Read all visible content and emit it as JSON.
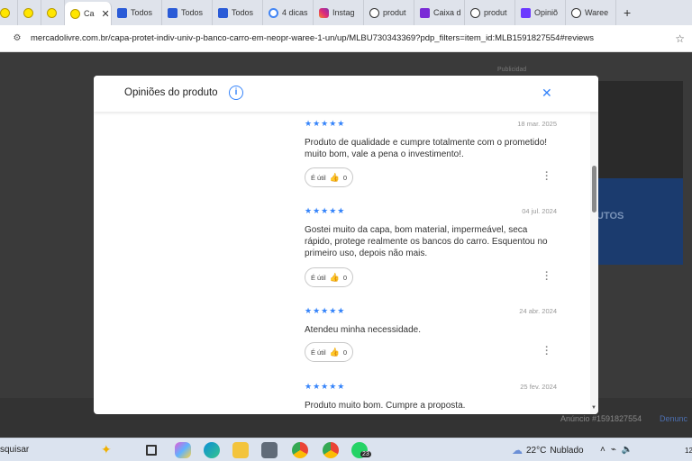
{
  "browser": {
    "tabs": [
      {
        "label": "",
        "icon": "mercadolivre-icon"
      },
      {
        "label": "",
        "icon": "mercadolivre-icon"
      },
      {
        "label": "",
        "icon": "mercadolivre-icon"
      },
      {
        "label": "Ca",
        "icon": "mercadolivre-icon",
        "active": true
      },
      {
        "label": "Todos",
        "icon": "todos-icon"
      },
      {
        "label": "Todos",
        "icon": "todos-icon"
      },
      {
        "label": "Todos",
        "icon": "todos-icon"
      },
      {
        "label": "4 dicas",
        "icon": "google-icon"
      },
      {
        "label": "Instag",
        "icon": "instagram-icon"
      },
      {
        "label": "produt",
        "icon": "globe-icon"
      },
      {
        "label": "Caixa d",
        "icon": "caixa-icon"
      },
      {
        "label": "produt",
        "icon": "globe-icon"
      },
      {
        "label": "Opiniõ",
        "icon": "opiniao-icon"
      },
      {
        "label": "Waree",
        "icon": "globe-icon"
      }
    ],
    "new_tab": "+",
    "close_tab": "✕",
    "url": "mercadolivre.com.br/capa-protet-indiv-univ-p-banco-carro-em-neopr-waree-1-un/up/MLBU730343369?pdp_filters=item_id:MLB1591827554#reviews"
  },
  "background_page": {
    "publicidad": "Publicidad",
    "banner_text": "UTOS",
    "anuncio": "Anúncio #1591827554",
    "denunciar": "Denunc"
  },
  "modal": {
    "title": "Opiniões do produto",
    "info": "i",
    "close": "✕",
    "accent": "#3483fa",
    "reviews": [
      {
        "rating": 5,
        "stars": "★★★★★",
        "date": "18 mar. 2025",
        "text": "Produto de qualidade e cumpre totalmente com o prometido! muito bom, vale a pena o investimento!.",
        "util_label": "É útil",
        "util_count": "0"
      },
      {
        "rating": 5,
        "stars": "★★★★★",
        "date": "04 jul. 2024",
        "text": "Gostei muito da capa, bom material, impermeável, seca rápido, protege realmente os bancos do carro. Esquentou no primeiro uso, depois não mais.",
        "util_label": "É útil",
        "util_count": "0"
      },
      {
        "rating": 5,
        "stars": "★★★★★",
        "date": "24 abr. 2024",
        "text": "Atendeu minha necessidade.",
        "util_label": "É útil",
        "util_count": "0"
      },
      {
        "rating": 5,
        "stars": "★★★★★",
        "date": "25 fev. 2024",
        "text": "Produto muito bom. Cumpre a proposta.",
        "util_label": "",
        "util_count": ""
      }
    ]
  },
  "taskbar": {
    "search": "squisar",
    "badge": "23",
    "temperature": "22°C",
    "weather": "Nublado",
    "clock": "12"
  }
}
